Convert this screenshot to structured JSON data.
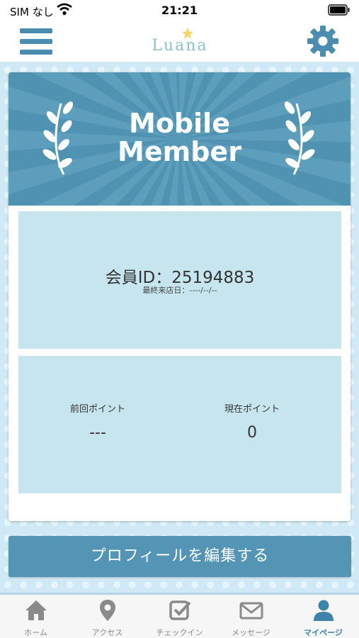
{
  "status_bar": {
    "carrier": "SIM なし",
    "time": "21:21"
  },
  "header": {
    "logo_text": "Luana",
    "menu_icon": "menu-icon",
    "settings_icon": "gear-icon"
  },
  "card": {
    "banner_title_line1": "Mobile",
    "banner_title_line2": "Member",
    "member_id": "会員ID：25194883",
    "last_visit": "最終来店日：----/--/--",
    "points": {
      "previous_label": "前回ポイント",
      "previous_value": "---",
      "current_label": "現在ポイント",
      "current_value": "0"
    }
  },
  "edit_button_label": "プロフィールを編集する",
  "tabs": [
    {
      "label": "ホーム",
      "icon": "home-icon"
    },
    {
      "label": "アクセス",
      "icon": "map-pin-icon"
    },
    {
      "label": "チェックイン",
      "icon": "checkin-icon"
    },
    {
      "label": "メッセージ",
      "icon": "envelope-icon"
    },
    {
      "label": "マイページ",
      "icon": "person-icon",
      "active": true
    }
  ],
  "colors": {
    "accent": "#4a8db0",
    "panel": "#c7e5ee",
    "active_tab": "#3d84a8",
    "inactive_tab": "#888888"
  }
}
